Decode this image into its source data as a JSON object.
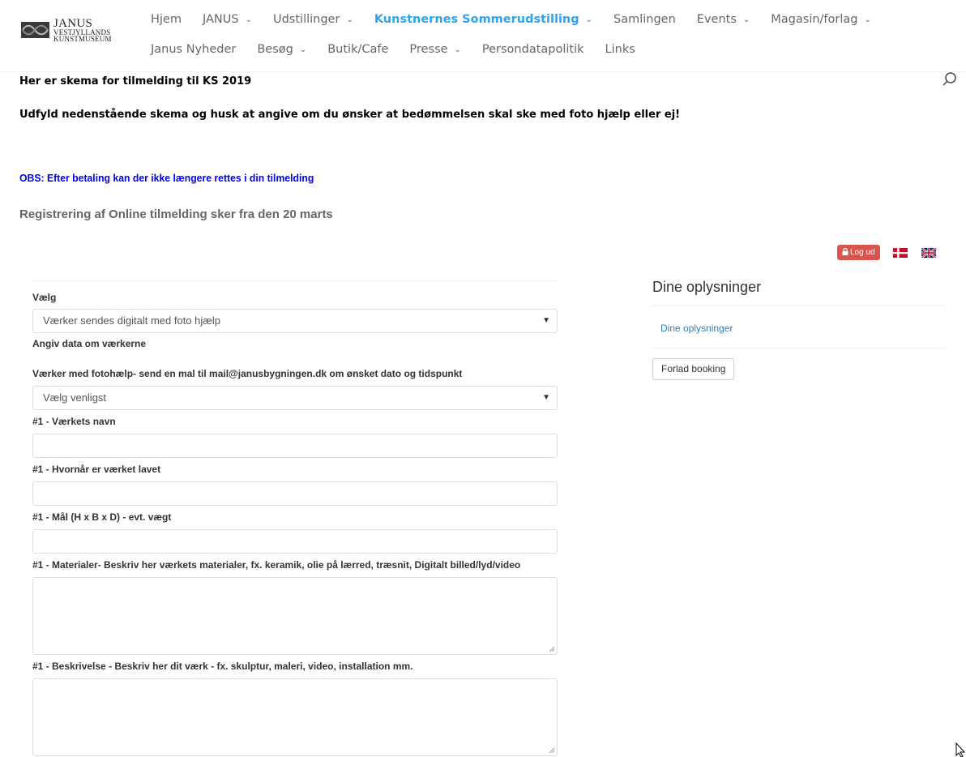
{
  "brand": {
    "line1": "JANUS",
    "line2": "VESTJYLLANDS",
    "line3": "KUNSTMUSEUM"
  },
  "nav": {
    "row1": [
      {
        "label": "Hjem",
        "dropdown": false,
        "active": false
      },
      {
        "label": "JANUS",
        "dropdown": true,
        "active": false
      },
      {
        "label": "Udstillinger",
        "dropdown": true,
        "active": false
      },
      {
        "label": "Kunstnernes Sommerudstilling",
        "dropdown": true,
        "active": true
      },
      {
        "label": "Samlingen",
        "dropdown": false,
        "active": false
      },
      {
        "label": "Events",
        "dropdown": true,
        "active": false
      },
      {
        "label": "Magasin/forlag",
        "dropdown": true,
        "active": false
      }
    ],
    "row2": [
      {
        "label": "Janus Nyheder",
        "dropdown": false,
        "active": false
      },
      {
        "label": "Besøg",
        "dropdown": true,
        "active": false
      },
      {
        "label": "Butik/Cafe",
        "dropdown": false,
        "active": false
      },
      {
        "label": "Presse",
        "dropdown": true,
        "active": false
      },
      {
        "label": "Persondatapolitik",
        "dropdown": false,
        "active": false
      },
      {
        "label": "Links",
        "dropdown": false,
        "active": false
      }
    ]
  },
  "intro": {
    "title": "Her er skema for tilmelding til KS 2019",
    "instruction": "Udfyld nedenstående skema og husk at angive om du ønsker at bedømmelsen skal ske med foto hjælp eller ej!",
    "obs": "OBS: Efter betaling kan der ikke længere rettes i din tilmelding",
    "registration": "Registrering af Online tilmelding sker fra den 20 marts"
  },
  "tools": {
    "logout_label": "Log ud"
  },
  "form": {
    "choose_label": "Vælg",
    "choose_value": "Værker sendes digitalt med foto hjælp",
    "works_data_label": "Angiv data om værkerne",
    "photo_help_label": "Værker med fotohælp- send en mal til mail@janusbygningen.dk om ønsket dato og tidspunkt",
    "photo_help_value": "Vælg venligst",
    "work_name_label": "#1 - Værkets navn",
    "work_date_label": "#1 - Hvornår er værket lavet",
    "work_size_label": "#1 - Mål (H x B x D) - evt. vægt",
    "materials_label": "#1 - Materialer- Beskriv her værkets materialer, fx. keramik, olie på lærred, træsnit, Digitalt billed/lyd/video",
    "description_label": "#1 - Beskrivelse - Beskriv her dit værk - fx. skulptur, maleri, video, installation mm."
  },
  "sidebar": {
    "title": "Dine oplysninger",
    "link": "Dine oplysninger",
    "leave_button": "Forlad booking"
  },
  "colors": {
    "accent": "#2ea3f2",
    "logout": "#d9534f",
    "obs": "#0000ee"
  }
}
